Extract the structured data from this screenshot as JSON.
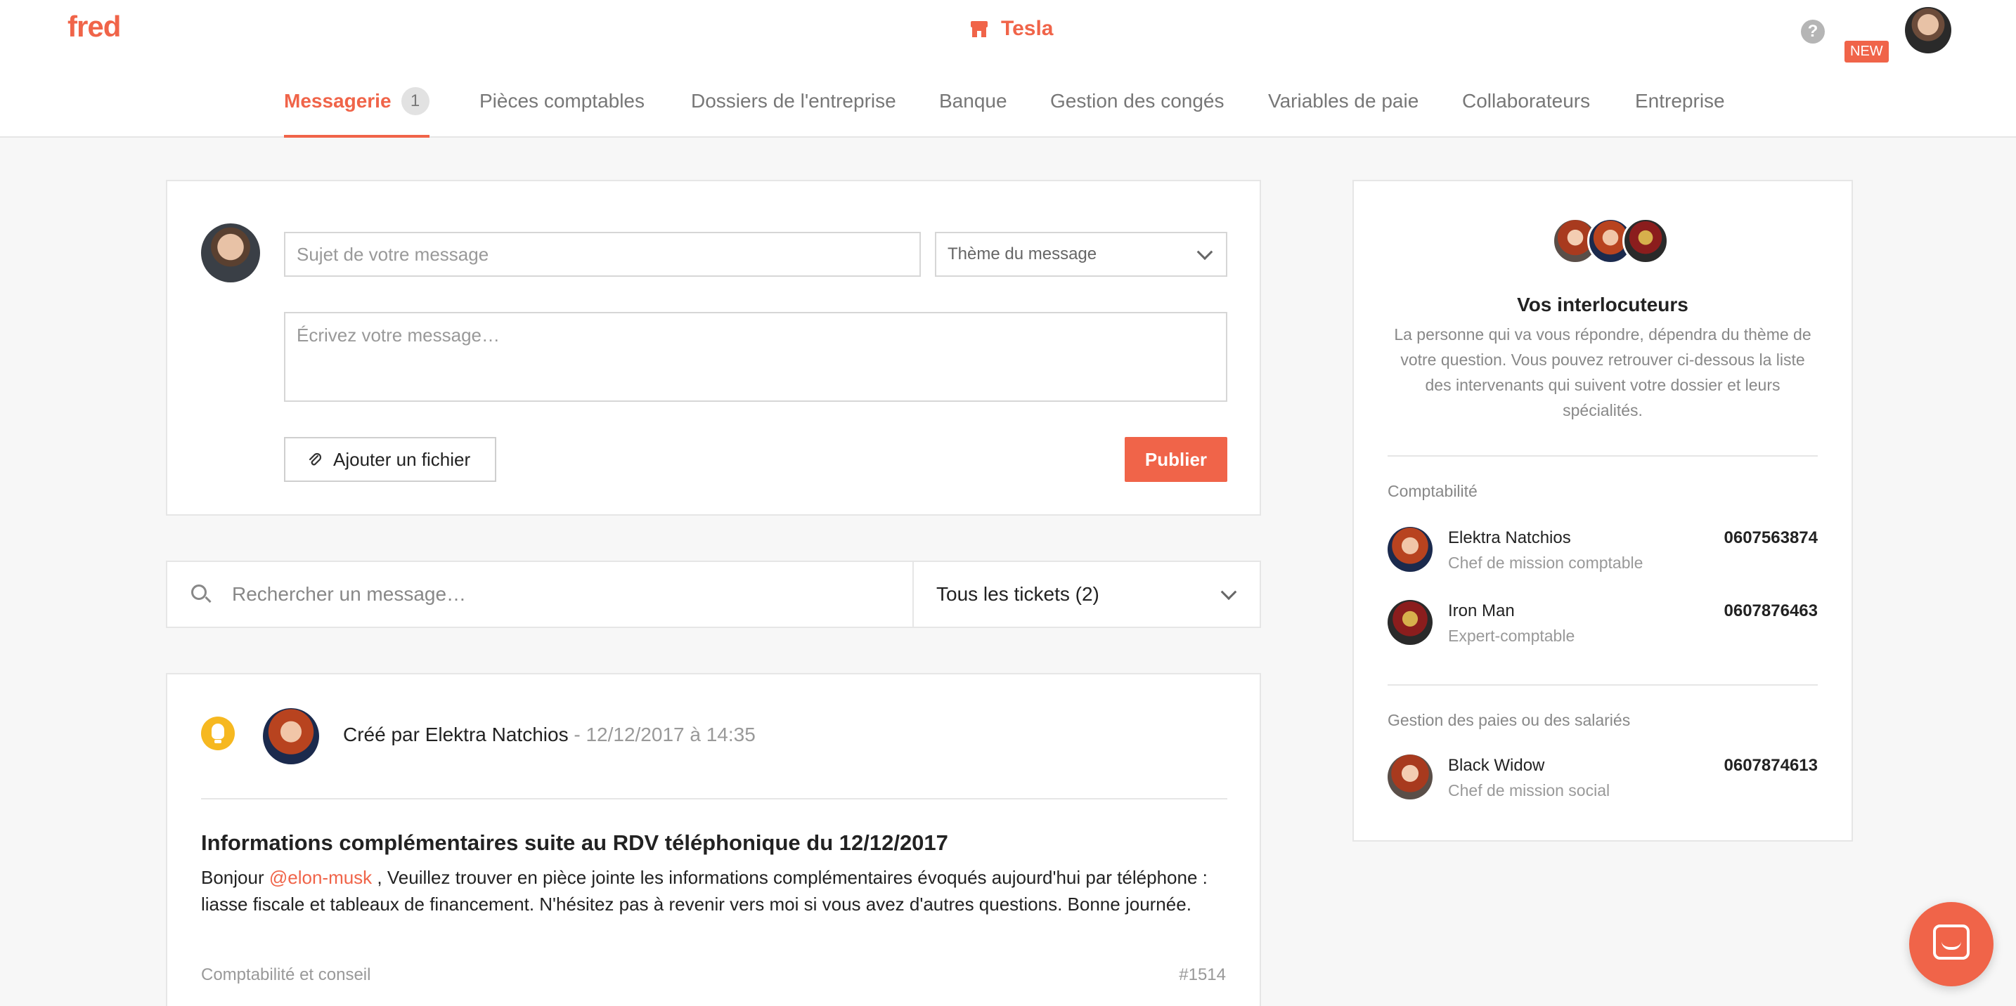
{
  "header": {
    "logo": "fred",
    "company": "Tesla",
    "company_icon": "store-icon",
    "help": "?",
    "new_badge": "NEW"
  },
  "tabs": [
    {
      "label": "Messagerie",
      "count": "1",
      "active": true
    },
    {
      "label": "Pièces comptables"
    },
    {
      "label": "Dossiers de l'entreprise"
    },
    {
      "label": "Banque"
    },
    {
      "label": "Gestion des congés"
    },
    {
      "label": "Variables de paie"
    },
    {
      "label": "Collaborateurs"
    },
    {
      "label": "Entreprise"
    }
  ],
  "composer": {
    "subject_placeholder": "Sujet de votre message",
    "theme_placeholder": "Thème du message",
    "message_placeholder": "Écrivez votre message…",
    "attach_label": "Ajouter un fichier",
    "publish_label": "Publier"
  },
  "search": {
    "placeholder": "Rechercher un message…",
    "filter_value": "Tous les tickets (2)"
  },
  "ticket": {
    "created_by": "Créé par Elektra Natchios",
    "date": "- 12/12/2017 à 14:35",
    "title": "Informations complémentaires suite au RDV téléphonique du 12/12/2017",
    "body_greeting": "Bonjour",
    "body_mention": "@elon-musk",
    "body_line1": ", Veuillez trouver en pièce jointe les informations complémentaires évoqués aujourd'hui par téléphone :",
    "body_line2": "liasse fiscale et tableaux de financement. N'hésitez pas à revenir vers moi si vous avez d'autres questions. Bonne journée.",
    "category": "Comptabilité et conseil",
    "number": "#1514"
  },
  "contacts": {
    "title": "Vos interlocuteurs",
    "description": "La personne qui va vous répondre, dépendra du thème de votre question. Vous pouvez retrouver ci-dessous la liste des intervenants qui suivent votre dossier et leurs spécialités.",
    "groups": [
      {
        "name": "Comptabilité",
        "people": [
          {
            "name": "Elektra Natchios",
            "role": "Chef de mission comptable",
            "phone": "0607563874"
          },
          {
            "name": "Iron Man",
            "role": "Expert-comptable",
            "phone": "0607876463"
          }
        ]
      },
      {
        "name": "Gestion des paies ou des salariés",
        "people": [
          {
            "name": "Black Widow",
            "role": "Chef de mission social",
            "phone": "0607874613"
          }
        ]
      }
    ]
  },
  "colors": {
    "accent": "#f06449",
    "bulb": "#f6b820"
  }
}
